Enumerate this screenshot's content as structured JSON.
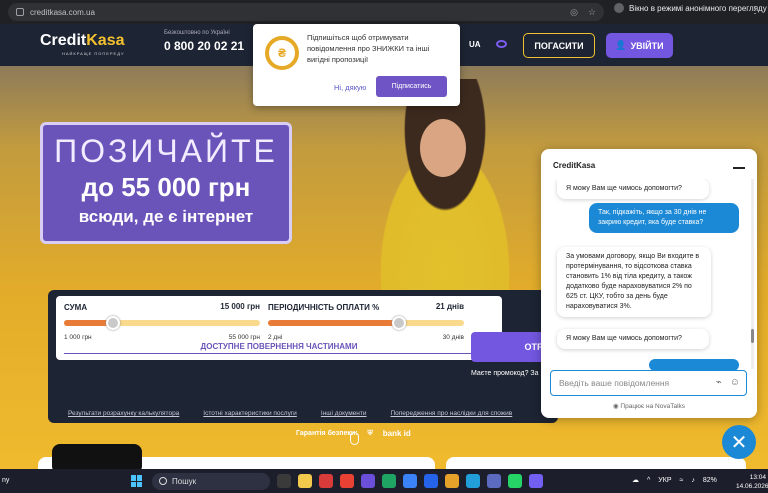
{
  "browser": {
    "url": "creditkasa.com.ua",
    "incognito": "Вікно в режимі анонімного перегляду"
  },
  "header": {
    "logo_main": "Credit",
    "logo_accent": "Kasa",
    "logo_tagline": "НАЙКРАЩЕ ПОПЕРЕДУ",
    "free_label": "Безкоштовно по Україні",
    "phone": "0 800 20 02 21",
    "lang": "UA",
    "register": "ПОГАСИТИ",
    "login": "УВІЙТИ"
  },
  "notification": {
    "message": "Підпишіться щоб отримувати повідомлення про ЗНИЖКИ та інші вигідні пропозиції",
    "no": "Ні, дякую",
    "yes": "Підписатись"
  },
  "promo": {
    "line1": "ПОЗИЧАЙТЕ",
    "line2": "до 55 000 грн",
    "line3": "всюди, де є інтернет"
  },
  "calculator": {
    "sum_label": "СУМА",
    "sum_value": "15 000 грн",
    "sum_min": "1 000 грн",
    "sum_max": "55 000 грн",
    "sum_fill": 0.25,
    "period_label": "ПЕРІОДИЧНІСТЬ ОПЛАТИ %",
    "period_value": "21 днів",
    "period_min": "2 дні",
    "period_max": "30 днів",
    "period_fill": 0.67,
    "partial": "ДОСТУПНЕ ПОВЕРНЕННЯ ЧАСТИНАМИ",
    "get_button": "ОТР",
    "promo_code": "Маєте промокод? За"
  },
  "links": [
    "Результати розрахунку калькулятора",
    "Істотні характеристики послуги",
    "Інші документи",
    "Попередження про наслідки для спожив"
  ],
  "guarantee": {
    "label": "Гарантія безпеки:",
    "bankid": "bank id"
  },
  "chat": {
    "title": "CreditKasa",
    "messages": [
      {
        "from": "bot",
        "text": "Я можу Вам ще чимось допомогти?"
      },
      {
        "from": "user",
        "text": "Так, підкажіть, якщо за 30 днів не закрию кредит, яка буде ставка?"
      },
      {
        "from": "bot",
        "text": "За умовами договору, якщо Ви входите в протермінування, то відсоткова ставка становить 1% від тіла кредиту, а також додатково буде нараховуватися 2% по 625 ст. ЦКУ, тобто за день буде нараховуватися 3%."
      },
      {
        "from": "bot",
        "text": "Я можу Вам ще чимось допомогти?"
      }
    ],
    "placeholder": "Введіть ваше повідомлення",
    "powered": "Працює на NovaTalks"
  },
  "taskbar": {
    "search": "Пошук",
    "left_text": "ny",
    "lang": "УКР",
    "battery": "82%",
    "time": "13:04",
    "date": "14.06.2026"
  }
}
